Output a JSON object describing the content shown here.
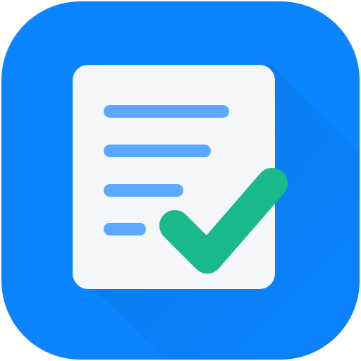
{
  "app_icon": {
    "icon_name": "task-list-check-icon",
    "colors": {
      "background": "#0A84FF",
      "shadow": "#0A6FD8",
      "document": "#F4F6F8",
      "lines": "#5AA8FF",
      "check": "#19B98B"
    }
  }
}
